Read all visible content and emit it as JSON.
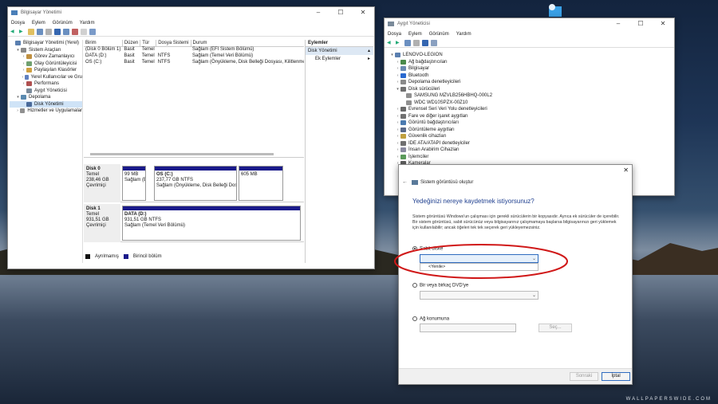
{
  "computer_management": {
    "title": "Bilgisayar Yönetimi",
    "menu": [
      "Dosya",
      "Eylem",
      "Görünüm",
      "Yardım"
    ],
    "tree": [
      {
        "label": "Bilgisayar Yönetimi (Yerel)",
        "level": 0,
        "arrow": ""
      },
      {
        "label": "Sistem Araçları",
        "level": 1,
        "arrow": "▾"
      },
      {
        "label": "Görev Zamanlayıcı",
        "level": 2,
        "arrow": "›"
      },
      {
        "label": "Olay Görüntüleyicisi",
        "level": 2,
        "arrow": "›"
      },
      {
        "label": "Paylaşılan Klasörler",
        "level": 2,
        "arrow": "›"
      },
      {
        "label": "Yerel Kullanıcılar ve Gru",
        "level": 2,
        "arrow": "›"
      },
      {
        "label": "Performans",
        "level": 2,
        "arrow": "›"
      },
      {
        "label": "Aygıt Yöneticisi",
        "level": 2,
        "arrow": ""
      },
      {
        "label": "Depolama",
        "level": 1,
        "arrow": "▾"
      },
      {
        "label": "Disk Yönetimi",
        "level": 2,
        "arrow": "",
        "selected": true
      },
      {
        "label": "Hizmetler ve Uygulamalar",
        "level": 1,
        "arrow": "›"
      }
    ],
    "table": {
      "headers": [
        "Birim",
        "Düzen",
        "Tür",
        "Dosya Sistemi",
        "Durum"
      ],
      "rows": [
        [
          "(Disk 0 Bölüm 1)",
          "Basit",
          "Temel",
          "",
          "Sağlam (EFI Sistem Bölümü)"
        ],
        [
          "DATA (D:)",
          "Basit",
          "Temel",
          "NTFS",
          "Sağlam (Temel Veri Bölümü)"
        ],
        [
          "OS (C:)",
          "Basit",
          "Temel",
          "NTFS",
          "Sağlam (Önyükleme, Disk Belleği Dosyası, Kilitlenme Bilg"
        ]
      ]
    },
    "disks": [
      {
        "name": "Disk 0",
        "type": "Temel",
        "size": "238,46 GB",
        "status": "Çevrimiçi",
        "parts": [
          {
            "name": "",
            "size": "99 MB",
            "status": "Sağlam (EFI S"
          },
          {
            "name": "OS (C:)",
            "size": "237,77 GB NTFS",
            "status": "Sağlam (Önyükleme, Disk Belleği Dosyası"
          },
          {
            "name": "",
            "size": "605 MB",
            "status": ""
          }
        ]
      },
      {
        "name": "Disk 1",
        "type": "Temel",
        "size": "931,51 GB",
        "status": "Çevrimiçi",
        "parts": [
          {
            "name": "DATA (D:)",
            "size": "931,51 GB NTFS",
            "status": "Sağlam (Temel Veri Bölümü)"
          }
        ]
      }
    ],
    "legend": [
      "Ayrılmamış",
      "Birincil bölüm"
    ],
    "actions": {
      "header": "Eylemler",
      "items": [
        "Disk Yönetimi",
        "Ek Eylemler"
      ]
    }
  },
  "device_manager": {
    "title": "Aygıt Yöneticisi",
    "menu": [
      "Dosya",
      "Eylem",
      "Görünüm",
      "Yardım"
    ],
    "tree": [
      {
        "label": "LENOVO-LEGION",
        "level": 0,
        "arrow": "▾"
      },
      {
        "label": "Ağ bağdaştırıcıları",
        "level": 1,
        "arrow": "›"
      },
      {
        "label": "Bilgisayar",
        "level": 1,
        "arrow": "›"
      },
      {
        "label": "Bluetooth",
        "level": 1,
        "arrow": "›"
      },
      {
        "label": "Depolama denetleyicileri",
        "level": 1,
        "arrow": "›"
      },
      {
        "label": "Disk sürücüleri",
        "level": 1,
        "arrow": "▾"
      },
      {
        "label": "SAMSUNG MZVLB256HBHQ-000L2",
        "level": 2,
        "arrow": ""
      },
      {
        "label": "WDC WD10SPZX-00Z10",
        "level": 2,
        "arrow": ""
      },
      {
        "label": "Evrensel Seri Veri Yolu denetleyicileri",
        "level": 1,
        "arrow": "›"
      },
      {
        "label": "Fare ve diğer işaret aygıtları",
        "level": 1,
        "arrow": "›"
      },
      {
        "label": "Görüntü bağdaştırıcıları",
        "level": 1,
        "arrow": "›"
      },
      {
        "label": "Görüntüleme aygıtları",
        "level": 1,
        "arrow": "›"
      },
      {
        "label": "Güvenlik cihazları",
        "level": 1,
        "arrow": "›"
      },
      {
        "label": "IDE ATA/ATAPI denetleyiciler",
        "level": 1,
        "arrow": "›"
      },
      {
        "label": "İnsan Arabirim Cihazları",
        "level": 1,
        "arrow": "›"
      },
      {
        "label": "İşlemciler",
        "level": 1,
        "arrow": "›"
      },
      {
        "label": "Kameralar",
        "level": 1,
        "arrow": "›"
      }
    ]
  },
  "backup_dialog": {
    "title": "Sistem görüntüsü oluştur",
    "heading": "Yedeğinizi nereye kaydetmek istiyorsunuz?",
    "description": "Sistem görüntüsü Windows'un çalışması için gerekli sürücülerin bir kopyasıdır. Ayrıca ek sürücüler de içerebilir. Bir sistem görüntüsü, sabit sürücünüz veya bilgisayarınız çalışmamaya başlarsa bilgisayarınızı geri yüklemek için kullanılabilir; ancak öğeleri tek tek seçerek geri yükleyemezsiniz.",
    "option_hdd": "Sabit diske",
    "hdd_dropdown_option": "<Yenile>",
    "option_dvd": "Bir veya birkaç DVD'ye",
    "option_network": "Ağ konumuna",
    "browse": "Seç...",
    "next": "Sonraki",
    "cancel": "İptal"
  },
  "watermark": "WALLPAPERSWIDE.COM"
}
